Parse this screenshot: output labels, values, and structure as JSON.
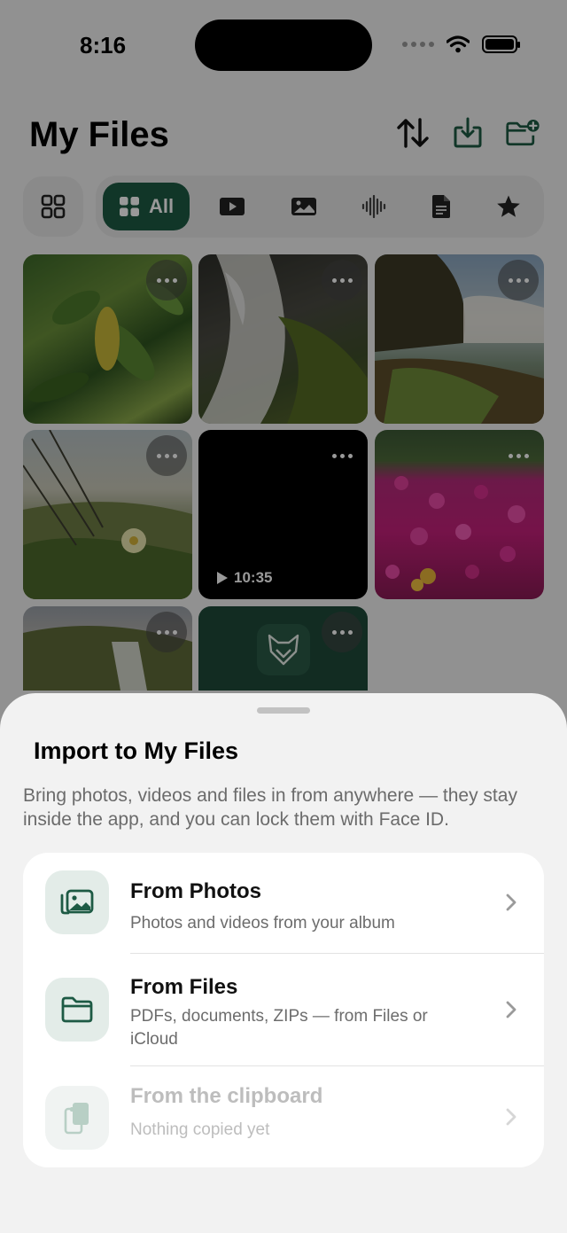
{
  "status_bar": {
    "time": "8:16"
  },
  "header": {
    "title": "My Files"
  },
  "filters": {
    "active_label": "All",
    "tabs": [
      "videos",
      "photos",
      "audio",
      "documents",
      "favorites"
    ]
  },
  "grid": {
    "tiles": [
      {
        "kind": "photo",
        "subject": "leaves"
      },
      {
        "kind": "photo",
        "subject": "waterfall"
      },
      {
        "kind": "photo",
        "subject": "waterfall-cliff"
      },
      {
        "kind": "photo",
        "subject": "beach-plants"
      },
      {
        "kind": "video",
        "duration": "10:35"
      },
      {
        "kind": "photo",
        "subject": "pink-flowers"
      },
      {
        "kind": "photo",
        "subject": "waterfall-hills"
      },
      {
        "kind": "app",
        "subject": "fox-logo"
      }
    ]
  },
  "sheet": {
    "title": "Import to My Files",
    "description": "Bring photos, videos and files in from anywhere — they stay inside the app, and you can lock them with Face ID.",
    "options": [
      {
        "title": "From Photos",
        "subtitle": "Photos and videos from your album",
        "icon": "photos-icon",
        "enabled": true
      },
      {
        "title": "From Files",
        "subtitle": "PDFs, documents, ZIPs — from Files or iCloud",
        "icon": "folder-icon",
        "enabled": true
      },
      {
        "title": "From the clipboard",
        "subtitle": "Nothing copied yet",
        "icon": "clipboard-icon",
        "enabled": false
      }
    ]
  },
  "colors": {
    "accent": "#1d5a44",
    "icon_bg": "#e3ece8",
    "sheet_bg": "#f2f2f2"
  }
}
